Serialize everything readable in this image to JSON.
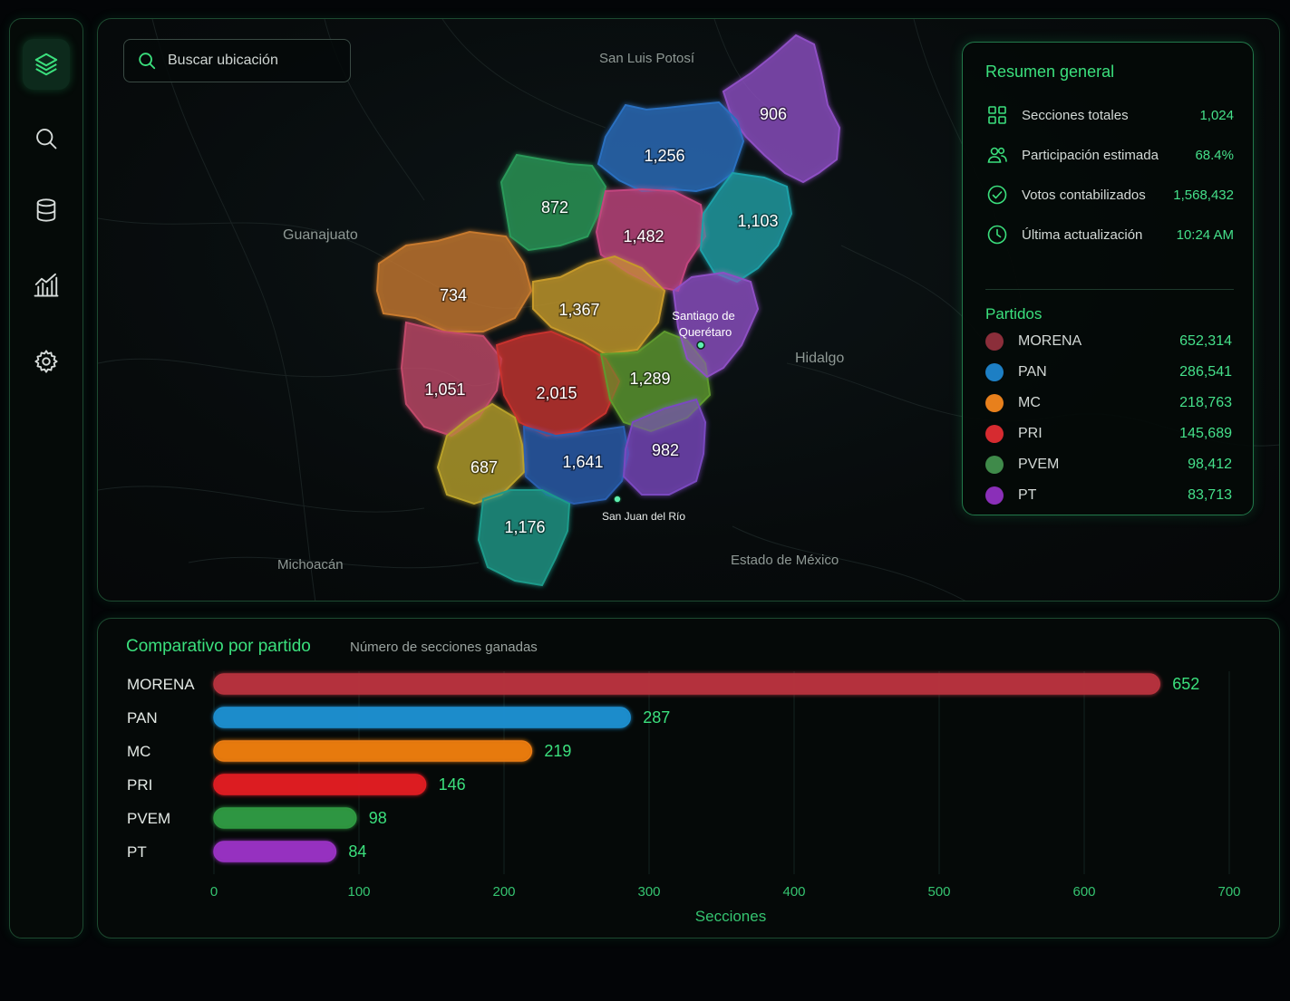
{
  "sidebar": {
    "items": [
      {
        "icon": "layers-icon",
        "active": true
      },
      {
        "icon": "search-icon",
        "active": false
      },
      {
        "icon": "database-icon",
        "active": false
      },
      {
        "icon": "chart-icon",
        "active": false
      },
      {
        "icon": "gear-icon",
        "active": false
      }
    ]
  },
  "map": {
    "search": {
      "placeholder": "Buscar ubicación"
    },
    "places": {
      "san_luis_potosi": "San Luis Potosí",
      "guanajuato": "Guanajuato",
      "hidalgo": "Hidalgo",
      "michoacan": "Michoacán",
      "estado_mexico": "Estado de México",
      "santiago_line1": "Santiago de",
      "santiago_line2": "Querétaro",
      "san_juan": "San Juan del Río"
    },
    "regions": [
      {
        "label": "906",
        "color": "#8e4fc4"
      },
      {
        "label": "1,256",
        "color": "#2a6fc0"
      },
      {
        "label": "872",
        "color": "#2a9a5a"
      },
      {
        "label": "1,482",
        "color": "#c2457f"
      },
      {
        "label": "1,103",
        "color": "#1fa0a8"
      },
      {
        "label": "734",
        "color": "#c87a2e"
      },
      {
        "label": "1,367",
        "color": "#c79a2a"
      },
      {
        "label": "1,051",
        "color": "#c24a6a"
      },
      {
        "label": "2,015",
        "color": "#c8332e"
      },
      {
        "label": "1,289",
        "color": "#5f9a2e"
      },
      {
        "label": "687",
        "color": "#b8a02a"
      },
      {
        "label": "1,641",
        "color": "#2a5fb0"
      },
      {
        "label": "982",
        "color": "#7a48c0"
      },
      {
        "label": "1,176",
        "color": "#1f9a8a"
      }
    ]
  },
  "summary": {
    "title": "Resumen general",
    "stats": [
      {
        "icon": "grid-icon",
        "label": "Secciones totales",
        "value": "1,024"
      },
      {
        "icon": "users-icon",
        "label": "Participación estimada",
        "value": "68.4%"
      },
      {
        "icon": "check-circle-icon",
        "label": "Votos contabilizados",
        "value": "1,568,432"
      },
      {
        "icon": "clock-icon",
        "label": "Última actualización",
        "value": "10:24 AM"
      }
    ],
    "parties_title": "Partidos",
    "parties": [
      {
        "name": "MORENA",
        "votes": "652,314",
        "color": "#8b2e3a"
      },
      {
        "name": "PAN",
        "votes": "286,541",
        "color": "#1d7fc4"
      },
      {
        "name": "MC",
        "votes": "218,763",
        "color": "#e8801c"
      },
      {
        "name": "PRI",
        "votes": "145,689",
        "color": "#d62b30"
      },
      {
        "name": "PVEM",
        "votes": "98,412",
        "color": "#3f8a4a"
      },
      {
        "name": "PT",
        "votes": "83,713",
        "color": "#8a2fb8"
      }
    ]
  },
  "chart": {
    "title": "Comparativo por partido",
    "subtitle": "Número de secciones ganadas"
  },
  "chart_data": {
    "type": "bar",
    "orientation": "horizontal",
    "categories": [
      "MORENA",
      "PAN",
      "MC",
      "PRI",
      "PVEM",
      "PT"
    ],
    "values": [
      652,
      287,
      219,
      146,
      98,
      84
    ],
    "colors": [
      "#b8323e",
      "#1f8fd0",
      "#ec7d12",
      "#e01b22",
      "#2f9a42",
      "#9a32c4"
    ],
    "xlabel": "Secciones",
    "ylabel": "",
    "xlim": [
      0,
      700
    ],
    "ticks": [
      0,
      100,
      200,
      300,
      400,
      500,
      600,
      700
    ],
    "grid": true
  }
}
